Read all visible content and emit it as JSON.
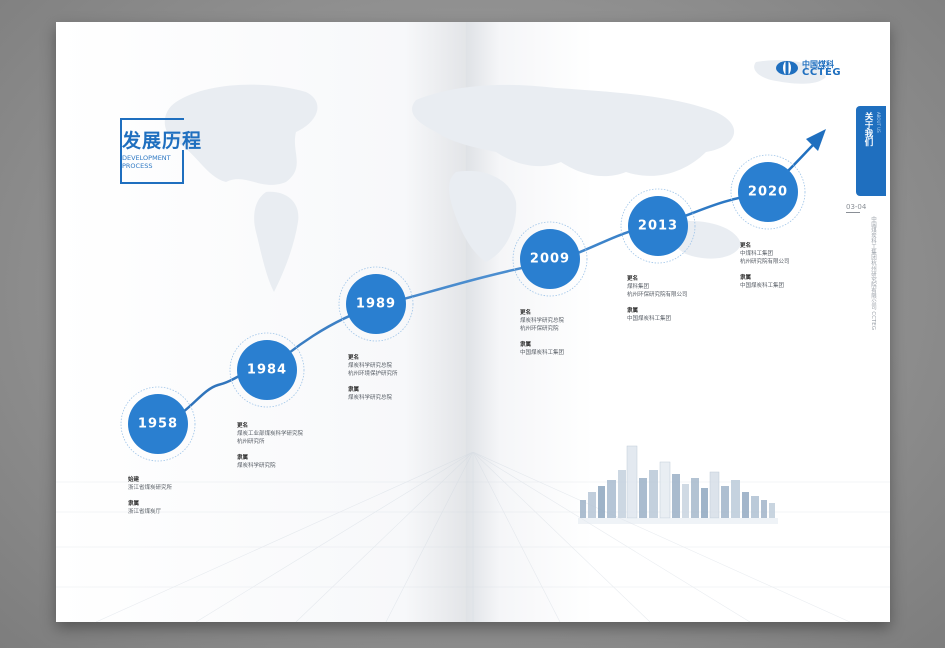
{
  "title": {
    "main": "发展历程",
    "sub_line1": "DEVELOPMENT",
    "sub_line2": "PROCESS"
  },
  "logo": {
    "zh": "中国煤科",
    "en": "CCTEG"
  },
  "side_tab": {
    "zh": "关于我们",
    "en": "ABOUT US"
  },
  "page_number": "03-04",
  "side_vertical_text": "中国煤炭科工集团杭州研究院有限公司 CCTEG",
  "colors": {
    "accent": "#1f6fbf",
    "circle": "#2a7fd0"
  },
  "milestones": [
    {
      "year": "1958",
      "h1": "始建",
      "v1": [
        "浙江省煤炭研究所"
      ],
      "h2": "隶属",
      "v2": [
        "浙江省煤炭厅"
      ]
    },
    {
      "year": "1984",
      "h1": "更名",
      "v1": [
        "煤炭工业部煤炭科学研究院",
        "杭州研究所"
      ],
      "h2": "隶属",
      "v2": [
        "煤炭科学研究院"
      ]
    },
    {
      "year": "1989",
      "h1": "更名",
      "v1": [
        "煤炭科学研究总院",
        "杭州环境保护研究所"
      ],
      "h2": "隶属",
      "v2": [
        "煤炭科学研究总院"
      ]
    },
    {
      "year": "2009",
      "h1": "更名",
      "v1": [
        "煤炭科学研究总院",
        "杭州环保研究院"
      ],
      "h2": "隶属",
      "v2": [
        "中国煤炭科工集团"
      ]
    },
    {
      "year": "2013",
      "h1": "更名",
      "v1": [
        "煤科集团",
        "杭州环保研究院有限公司"
      ],
      "h2": "隶属",
      "v2": [
        "中国煤炭科工集团"
      ]
    },
    {
      "year": "2020",
      "h1": "更名",
      "v1": [
        "中煤科工集团",
        "杭州研究院有限公司"
      ],
      "h2": "隶属",
      "v2": [
        "中国煤炭科工集团"
      ]
    }
  ]
}
